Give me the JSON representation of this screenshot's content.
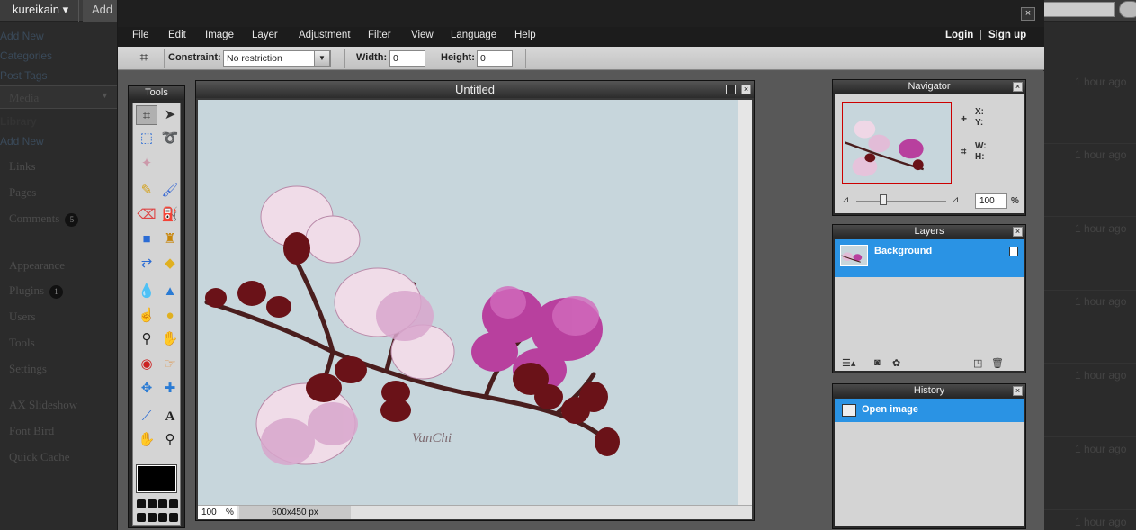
{
  "wp": {
    "account": "kureikain ▾",
    "add_label": "Add",
    "sidebar": [
      {
        "label": "Add New",
        "kind": "sub"
      },
      {
        "label": "Categories",
        "kind": "sub"
      },
      {
        "label": "Post Tags",
        "kind": "sub"
      },
      {
        "label": "Media",
        "kind": "header"
      },
      {
        "label": "Library",
        "kind": "sub"
      },
      {
        "label": "Add New",
        "kind": "sub"
      },
      {
        "label": "Links",
        "kind": "menu"
      },
      {
        "label": "Pages",
        "kind": "menu"
      },
      {
        "label": "Comments",
        "kind": "menu",
        "badge": "5"
      },
      {
        "label": "Appearance",
        "kind": "menu"
      },
      {
        "label": "Plugins",
        "kind": "menu",
        "badge": "1"
      },
      {
        "label": "Users",
        "kind": "menu"
      },
      {
        "label": "Tools",
        "kind": "menu"
      },
      {
        "label": "Settings",
        "kind": "menu"
      },
      {
        "label": "AX Slideshow",
        "kind": "menu"
      },
      {
        "label": "Font Bird",
        "kind": "menu"
      },
      {
        "label": "Quick Cache",
        "kind": "menu"
      }
    ],
    "times": [
      "1 hour ago",
      "1 hour ago",
      "1 hour ago",
      "1 hour ago",
      "1 hour ago",
      "1 hour ago",
      "1 hour ago"
    ]
  },
  "editor": {
    "close": "×",
    "menu": [
      "File",
      "Edit",
      "Image",
      "Layer",
      "Adjustment",
      "Filter",
      "View",
      "Language",
      "Help"
    ],
    "login": "Login",
    "separator": "|",
    "signup": "Sign up",
    "options": {
      "constraint_label": "Constraint:",
      "constraint_value": "No restriction",
      "width_label": "Width:",
      "width_value": "0",
      "height_label": "Height:",
      "height_value": "0"
    },
    "tools_title": "Tools",
    "doc": {
      "title": "Untitled",
      "zoom": "100",
      "zoom_unit": "%",
      "size": "600x450 px",
      "watermark": "VanChi"
    },
    "navigator": {
      "title": "Navigator",
      "x": "X:",
      "y": "Y:",
      "w": "W:",
      "h": "H:",
      "zoom": "100",
      "unit": "%"
    },
    "layers": {
      "title": "Layers",
      "items": [
        "Background"
      ]
    },
    "history": {
      "title": "History",
      "items": [
        "Open image"
      ]
    }
  }
}
